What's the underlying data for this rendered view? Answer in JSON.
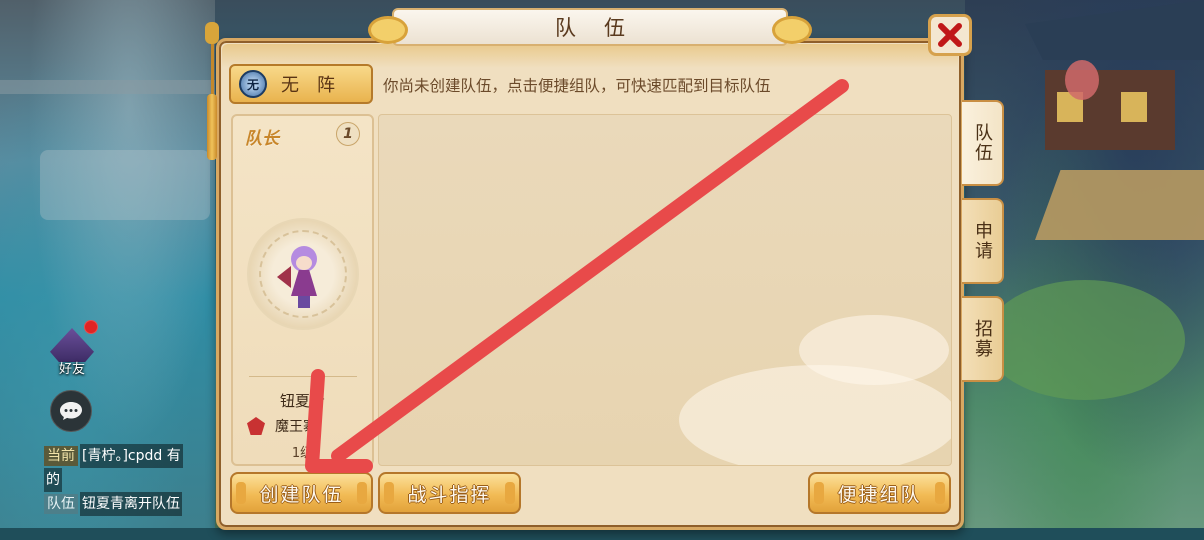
{
  "panel": {
    "title": "队伍",
    "close_icon": "close-x-icon"
  },
  "formation": {
    "badge": "无",
    "label": "无阵",
    "hint": "你尚未创建队伍，点击便捷组队，可快速匹配到目标队伍"
  },
  "member": {
    "role": "队长",
    "slot": "1",
    "name": "钮夏青",
    "class": "魔王寨",
    "level": "1级"
  },
  "tabs": [
    {
      "label": "队伍",
      "active": true
    },
    {
      "label": "申请",
      "active": false
    },
    {
      "label": "招募",
      "active": false
    }
  ],
  "buttons": {
    "create_team": "创建队伍",
    "battle_command": "战斗指挥",
    "quick_team": "便捷组队"
  },
  "hud": {
    "friends_label": "好友",
    "chat_icon": "chat-bubble-icon"
  },
  "chat": [
    {
      "tag": "当前",
      "text": "[青柠。]cpdd 有"
    },
    {
      "tag": "",
      "text": "的"
    },
    {
      "tag": "队伍",
      "text": "钮夏青离开队伍"
    }
  ],
  "annotation": {
    "arrow_color": "#e84a4a"
  }
}
